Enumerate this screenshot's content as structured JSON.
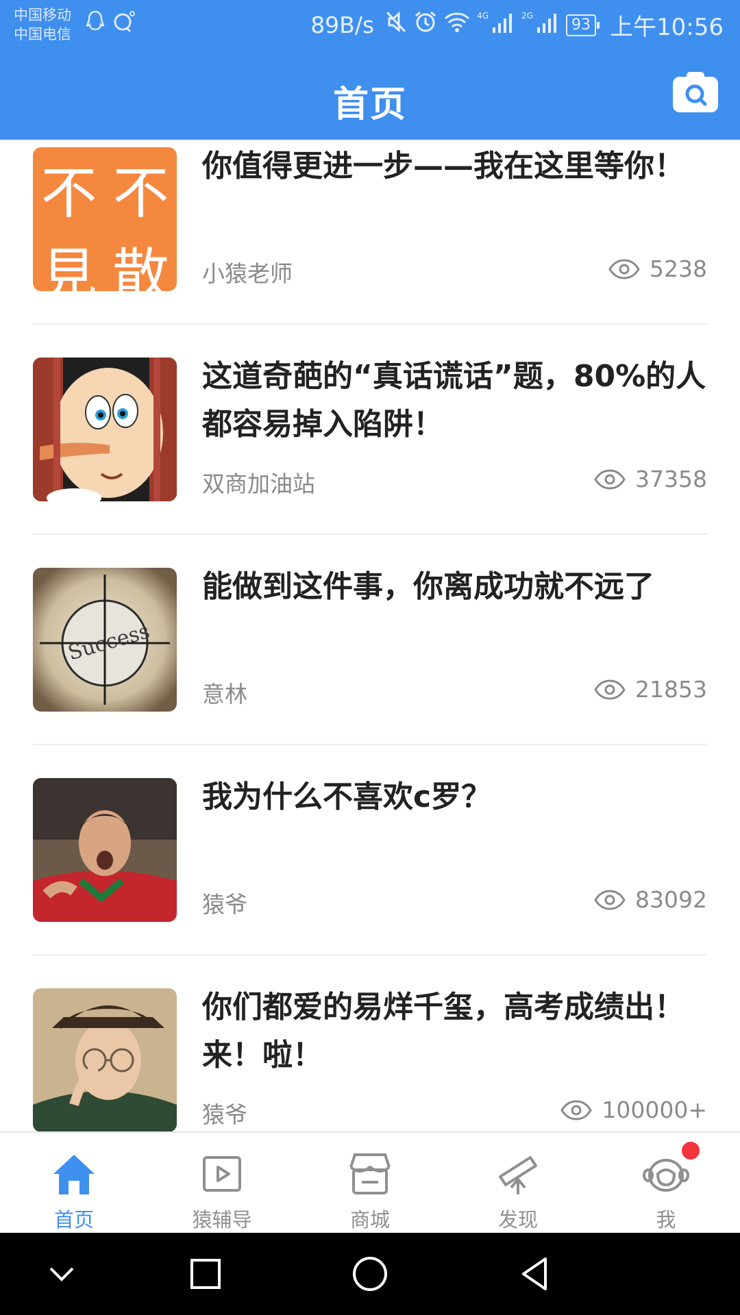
{
  "status_bar": {
    "carrier_1": "中国移动",
    "carrier_2": "中国电信",
    "net_speed": "89B/s",
    "net_4g": "4G",
    "net_2g": "2G",
    "battery": "93",
    "time": "上午10:56"
  },
  "header": {
    "title": "首页",
    "camera_icon": "camera-search-icon"
  },
  "articles": [
    {
      "title": "你值得更进一步——我在这里等你！",
      "author": "小猿老师",
      "views": "5238",
      "thumb_chars": [
        "不",
        "不",
        "見",
        "散"
      ],
      "thumb_color": "#f4883f"
    },
    {
      "title": "这道奇葩的“真话谎话”题，80%的人都容易掉入陷阱！",
      "author": "双商加油站",
      "views": "37358",
      "thumb_icon": "cartoon-puppet-image"
    },
    {
      "title": "能做到这件事，你离成功就不远了",
      "author": "意林",
      "views": "21853",
      "thumb_icon": "success-target-image",
      "thumb_text": "Success"
    },
    {
      "title": "我为什么不喜欢c罗？",
      "author": "猿爷",
      "views": "83092",
      "thumb_icon": "soccer-player-image"
    },
    {
      "title": "你们都爱的易烊千玺，高考成绩出！来！啦！",
      "author": "猿爷",
      "views": "100000+",
      "thumb_icon": "young-man-portrait-image"
    }
  ],
  "bottom_nav": [
    {
      "label": "首页",
      "icon": "home-icon",
      "active": true
    },
    {
      "label": "猿辅导",
      "icon": "video-play-icon",
      "active": false
    },
    {
      "label": "商城",
      "icon": "store-icon",
      "active": false
    },
    {
      "label": "发现",
      "icon": "telescope-icon",
      "active": false
    },
    {
      "label": "我",
      "icon": "monkey-face-icon",
      "active": false,
      "badge": true
    }
  ],
  "colors": {
    "accent": "#3f8fef",
    "title_text": "#222222",
    "meta_text": "#8a8a8a",
    "badge": "#f0353d"
  }
}
